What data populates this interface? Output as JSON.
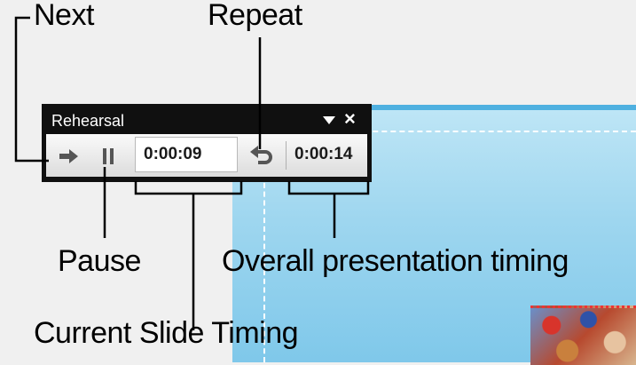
{
  "callouts": {
    "next": "Next",
    "repeat": "Repeat",
    "pause": "Pause",
    "overall": "Overall presentation timing",
    "current": "Current Slide Timing"
  },
  "toolbar": {
    "title": "Rehearsal",
    "dropdown_icon": "triangle-down-icon",
    "close_label": "×",
    "next_icon": "arrow-right-icon",
    "pause_icon": "pause-icon",
    "repeat_icon": "undo-arrow-icon",
    "current_slide_time": "0:00:09",
    "overall_time": "0:00:14"
  },
  "colors": {
    "toolbar_bg": "#101010",
    "slide_top": "#bfe6f6",
    "slide_bottom": "#7fc8ea"
  }
}
